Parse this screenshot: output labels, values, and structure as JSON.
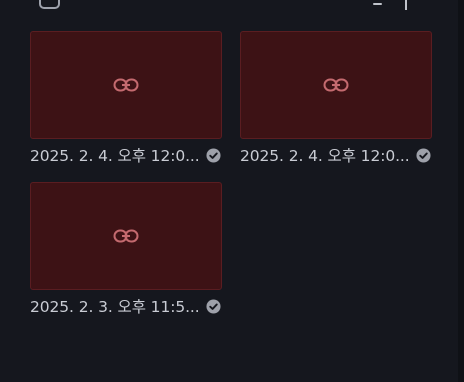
{
  "toolbar": {
    "select_all_icon": "checkbox-icon",
    "collapse_icon": "minus-icon",
    "sort_icon": "sort-arrows-icon"
  },
  "items": [
    {
      "title": "2025. 2. 4. 오후 12:0...",
      "icon": "link-icon",
      "status": "checked"
    },
    {
      "title": "2025. 2. 4. 오후 12:0...",
      "icon": "link-icon",
      "status": "checked"
    },
    {
      "title": "2025. 2. 3. 오후 11:5...",
      "icon": "link-icon",
      "status": "checked"
    }
  ],
  "colors": {
    "background": "#15171e",
    "thumbnail_fill": "#3d1215",
    "thumbnail_border": "#5a1d21",
    "link_icon": "#c46a6f",
    "check_badge": "#9ea1aa"
  }
}
